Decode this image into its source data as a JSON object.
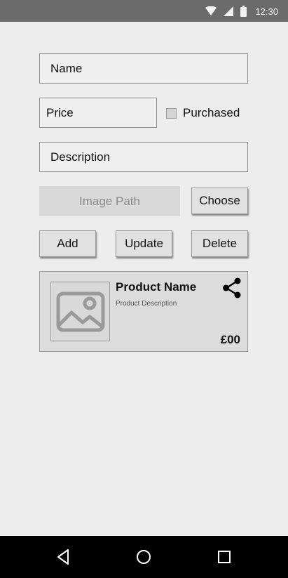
{
  "status_bar": {
    "time": "12:30",
    "icons": [
      "wifi-icon",
      "cellular-signal-icon",
      "battery-icon"
    ]
  },
  "form": {
    "name_field": {
      "value": "Name"
    },
    "price_field": {
      "value": "Price"
    },
    "purchased_checkbox": {
      "label": "Purchased",
      "checked": false
    },
    "description_field": {
      "value": "Description"
    },
    "image_path_field": {
      "value": "Image Path"
    },
    "choose_button": {
      "label": "Choose"
    }
  },
  "actions": {
    "add_label": "Add",
    "update_label": "Update",
    "delete_label": "Delete"
  },
  "product_card": {
    "name": "Product Name",
    "description": "Product Description",
    "price": "£00",
    "image_icon": "image-placeholder-icon",
    "share_icon": "share-icon"
  },
  "nav_bar": {
    "buttons": [
      "back-icon",
      "home-icon",
      "recents-icon"
    ]
  },
  "colors": {
    "status_bar": "#6b6b6b",
    "background": "#ededed",
    "nav_bar": "#000000",
    "card": "#dcdcdc",
    "disabled_field": "#d9d9d9"
  }
}
